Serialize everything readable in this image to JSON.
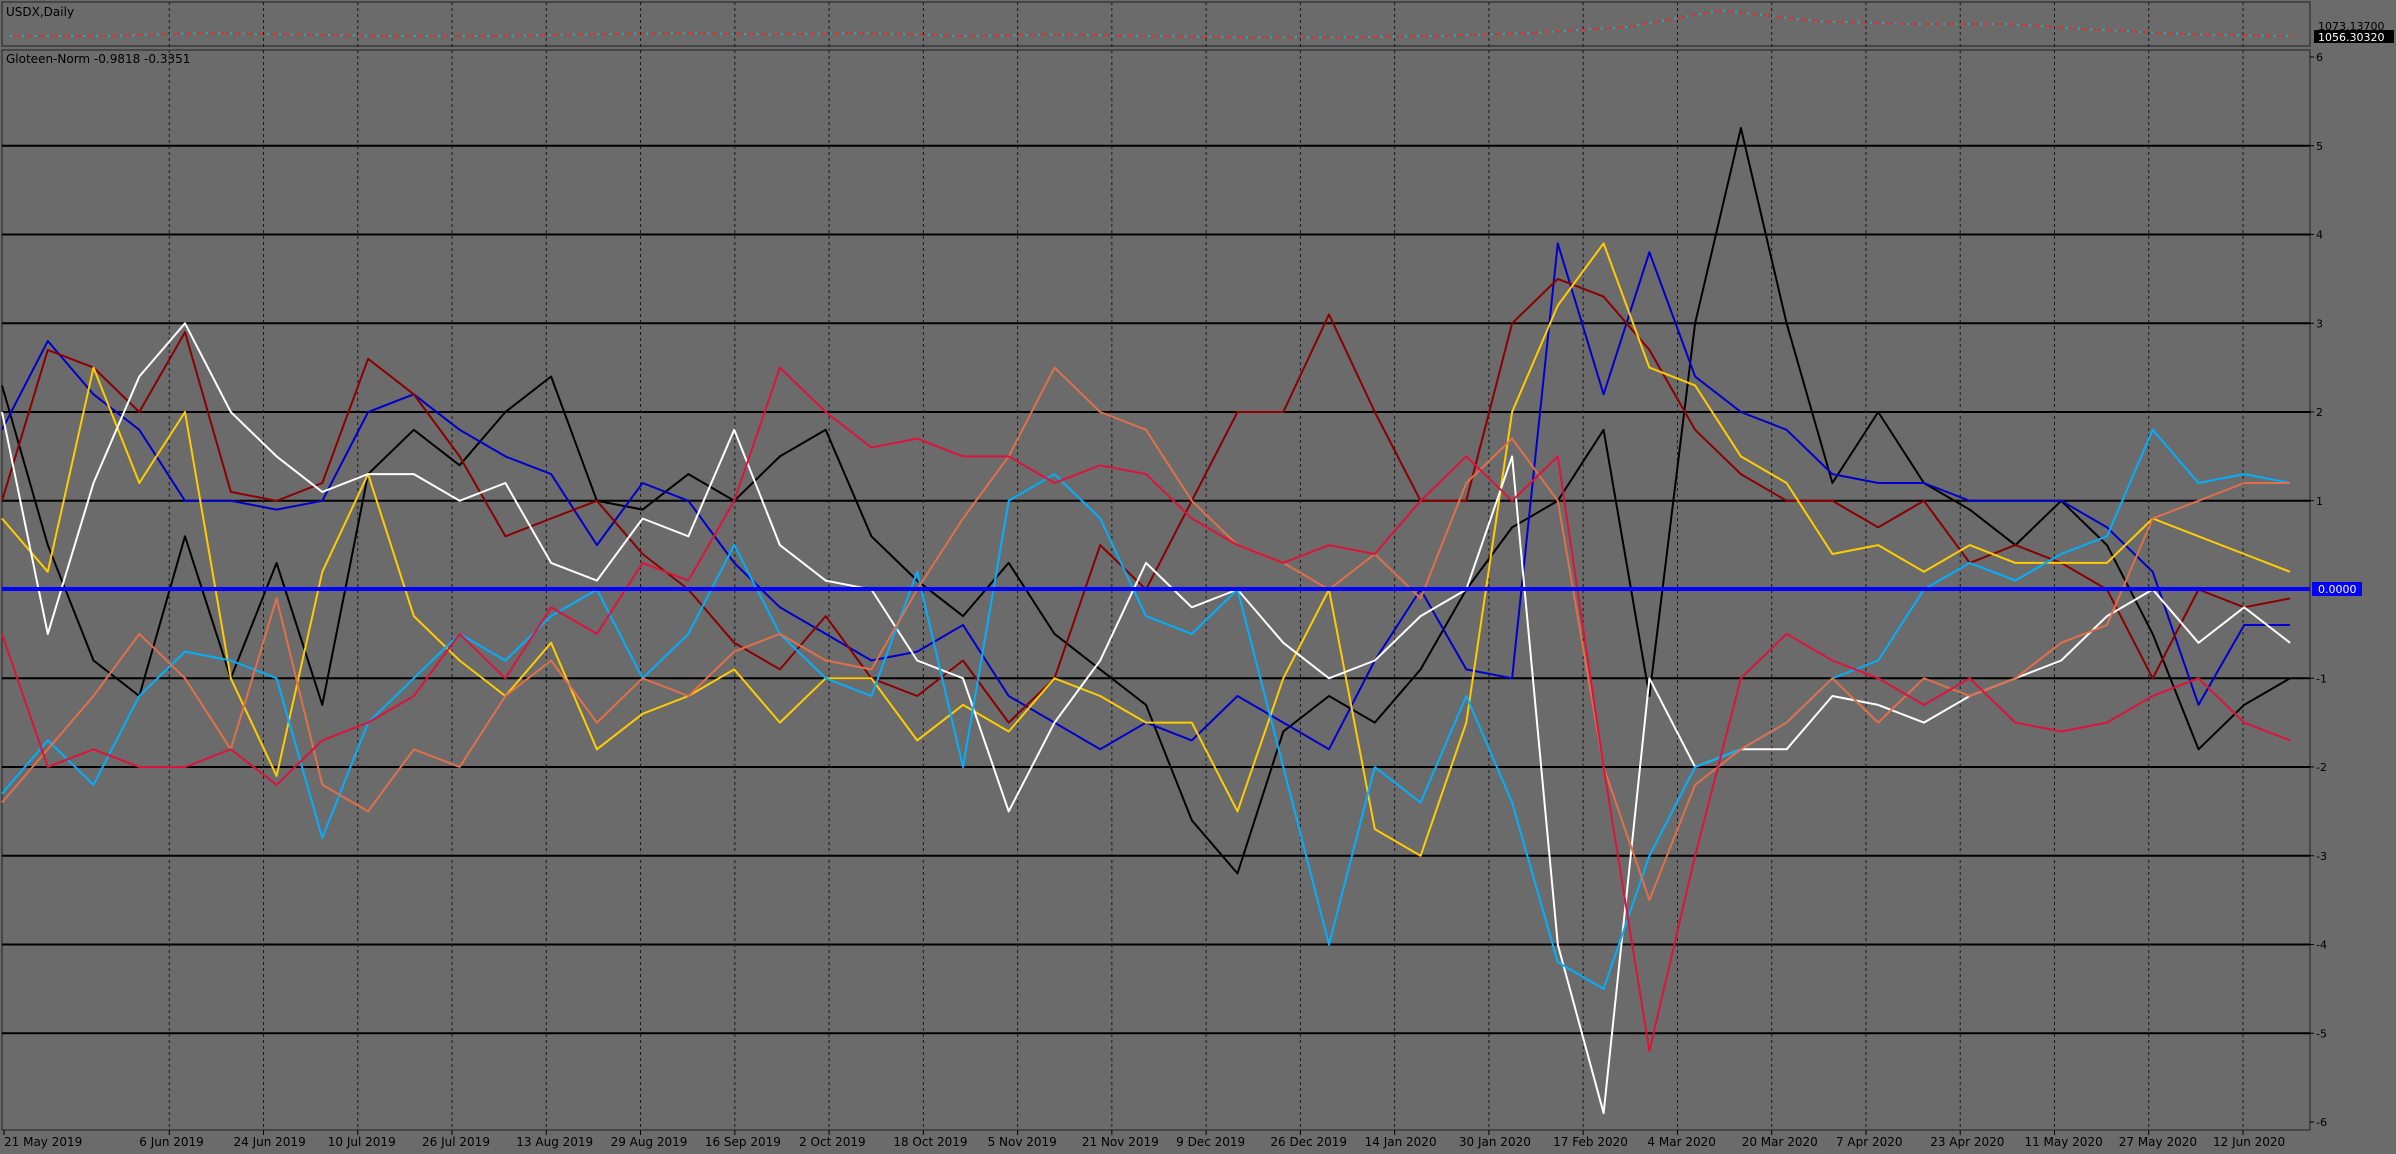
{
  "window": {
    "symbol_label": "USDX,Daily",
    "indicator_label": "Gloteen-Norm -0.9818 -0.3351"
  },
  "top_panel": {
    "price_high_label": "1073.13700",
    "price_current_label": "1056.30320",
    "colors": {
      "up": "#00c0c0",
      "down": "#ff2020",
      "background": "#6b6b6b"
    }
  },
  "zero_marker_label": "0.0000",
  "colors": {
    "background": "#6b6b6b",
    "grid_solid": "#000000",
    "grid_dashed": "#1a1a1a",
    "zero_line": "#0000ff",
    "axis_text": "#000000"
  },
  "chart_data": {
    "type": "line",
    "x_labels": [
      "21 May 2019",
      "6 Jun 2019",
      "24 Jun 2019",
      "10 Jul 2019",
      "26 Jul 2019",
      "13 Aug 2019",
      "29 Aug 2019",
      "16 Sep 2019",
      "2 Oct 2019",
      "18 Oct 2019",
      "5 Nov 2019",
      "21 Nov 2019",
      "9 Dec 2019",
      "26 Dec 2019",
      "14 Jan 2020",
      "30 Jan 2020",
      "17 Feb 2020",
      "4 Mar 2020",
      "20 Mar 2020",
      "7 Apr 2020",
      "23 Apr 2020",
      "11 May 2020",
      "27 May 2020",
      "12 Jun 2020"
    ],
    "y_ticks": [
      "6",
      "5",
      "4",
      "3",
      "2",
      "1",
      "-1",
      "-2",
      "-3",
      "-4",
      "-5",
      "-6"
    ],
    "ylim": [
      -6,
      6
    ],
    "grid": true,
    "zero_line": 0,
    "series": [
      {
        "color": "#000000",
        "values": [
          2.3,
          0.5,
          -0.8,
          -1.2,
          0.6,
          -1.0,
          0.3,
          -1.3,
          1.3,
          1.8,
          1.4,
          2.0,
          2.4,
          1.0,
          0.9,
          1.3,
          1.0,
          1.5,
          1.8,
          0.6,
          0.1,
          -0.3,
          0.3,
          -0.5,
          -0.9,
          -1.3,
          -2.6,
          -3.2,
          -1.6,
          -1.2,
          -1.5,
          -0.9,
          0.0,
          0.7,
          1.0,
          1.8,
          -1.2,
          3.0,
          5.2,
          3.0,
          1.2,
          2.0,
          1.2,
          0.9,
          0.5,
          1.0,
          0.5,
          -0.5,
          -1.8,
          -1.3,
          -1.0
        ]
      },
      {
        "color": "#0000cc",
        "values": [
          1.8,
          2.8,
          2.2,
          1.8,
          1.0,
          1.0,
          0.9,
          1.0,
          2.0,
          2.2,
          1.8,
          1.5,
          1.3,
          0.5,
          1.2,
          1.0,
          0.3,
          -0.2,
          -0.5,
          -0.8,
          -0.7,
          -0.4,
          -1.2,
          -1.5,
          -1.8,
          -1.5,
          -1.7,
          -1.2,
          -1.5,
          -1.8,
          -0.8,
          0.0,
          -0.9,
          -1.0,
          3.9,
          2.2,
          3.8,
          2.4,
          2.0,
          1.8,
          1.3,
          1.2,
          1.2,
          1.0,
          1.0,
          1.0,
          0.7,
          0.2,
          -1.3,
          -0.4,
          -0.4
        ]
      },
      {
        "color": "#8b0000",
        "values": [
          1.0,
          2.7,
          2.5,
          2.0,
          2.9,
          1.1,
          1.0,
          1.2,
          2.6,
          2.2,
          1.5,
          0.6,
          0.8,
          1.0,
          0.4,
          0.0,
          -0.6,
          -0.9,
          -0.3,
          -1.0,
          -1.2,
          -0.8,
          -1.5,
          -1.0,
          0.5,
          0.0,
          1.0,
          2.0,
          2.0,
          3.1,
          2.0,
          1.0,
          1.0,
          3.0,
          3.5,
          3.3,
          2.7,
          1.8,
          1.3,
          1.0,
          1.0,
          0.7,
          1.0,
          0.3,
          0.5,
          0.3,
          0.0,
          -1.0,
          0.0,
          -0.2,
          -0.1
        ]
      },
      {
        "color": "#ffcc00",
        "values": [
          0.8,
          0.2,
          2.5,
          1.2,
          2.0,
          -1.0,
          -2.1,
          0.2,
          1.3,
          -0.3,
          -0.8,
          -1.2,
          -0.6,
          -1.8,
          -1.4,
          -1.2,
          -0.9,
          -1.5,
          -1.0,
          -1.0,
          -1.7,
          -1.3,
          -1.6,
          -1.0,
          -1.2,
          -1.5,
          -1.5,
          -2.5,
          -1.0,
          0.0,
          -2.7,
          -3.0,
          -1.5,
          2.0,
          3.2,
          3.9,
          2.5,
          2.3,
          1.5,
          1.2,
          0.4,
          0.5,
          0.2,
          0.5,
          0.3,
          0.3,
          0.3,
          0.8,
          0.6,
          0.4,
          0.2
        ]
      },
      {
        "color": "#ffffff",
        "values": [
          2.0,
          -0.5,
          1.2,
          2.4,
          3.0,
          2.0,
          1.5,
          1.1,
          1.3,
          1.3,
          1.0,
          1.2,
          0.3,
          0.1,
          0.8,
          0.6,
          1.8,
          0.5,
          0.1,
          0.0,
          -0.8,
          -1.0,
          -2.5,
          -1.5,
          -0.8,
          0.3,
          -0.2,
          0.0,
          -0.6,
          -1.0,
          -0.8,
          -0.3,
          0.0,
          1.5,
          -4.0,
          -5.9,
          -1.0,
          -2.0,
          -1.8,
          -1.8,
          -1.2,
          -1.3,
          -1.5,
          -1.2,
          -1.0,
          -0.8,
          -0.3,
          0.0,
          -0.6,
          -0.2,
          -0.6
        ]
      },
      {
        "color": "#00b0ff",
        "values": [
          -2.3,
          -1.7,
          -2.2,
          -1.2,
          -0.7,
          -0.8,
          -1.0,
          -2.8,
          -1.5,
          -1.0,
          -0.5,
          -0.8,
          -0.3,
          0.0,
          -1.0,
          -0.5,
          0.5,
          -0.5,
          -1.0,
          -1.2,
          0.2,
          -2.0,
          1.0,
          1.3,
          0.8,
          -0.3,
          -0.5,
          0.0,
          -2.0,
          -4.0,
          -2.0,
          -2.4,
          -1.2,
          -2.4,
          -4.2,
          -4.5,
          -3.0,
          -2.0,
          -1.8,
          -1.5,
          -1.0,
          -0.8,
          0.0,
          0.3,
          0.1,
          0.4,
          0.6,
          1.8,
          1.2,
          1.3,
          1.2
        ]
      },
      {
        "color": "#e0704a",
        "values": [
          -2.4,
          -1.8,
          -1.2,
          -0.5,
          -1.0,
          -1.8,
          -0.1,
          -2.2,
          -2.5,
          -1.8,
          -2.0,
          -1.2,
          -0.8,
          -1.5,
          -1.0,
          -1.2,
          -0.7,
          -0.5,
          -0.8,
          -0.9,
          0.0,
          0.8,
          1.5,
          2.5,
          2.0,
          1.8,
          1.0,
          0.5,
          0.3,
          0.0,
          0.4,
          -0.1,
          1.2,
          1.7,
          1.0,
          -2.0,
          -3.5,
          -2.2,
          -1.8,
          -1.5,
          -1.0,
          -1.5,
          -1.0,
          -1.2,
          -1.0,
          -0.6,
          -0.4,
          0.8,
          1.0,
          1.2,
          1.2
        ]
      },
      {
        "color": "#dc143c",
        "values": [
          -0.5,
          -2.0,
          -1.8,
          -2.0,
          -2.0,
          -1.8,
          -2.2,
          -1.7,
          -1.5,
          -1.2,
          -0.5,
          -1.0,
          -0.2,
          -0.5,
          0.3,
          0.1,
          1.0,
          2.5,
          2.0,
          1.6,
          1.7,
          1.5,
          1.5,
          1.2,
          1.4,
          1.3,
          0.8,
          0.5,
          0.3,
          0.5,
          0.4,
          1.0,
          1.5,
          1.0,
          1.5,
          -2.0,
          -5.2,
          -3.0,
          -1.0,
          -0.5,
          -0.8,
          -1.0,
          -1.3,
          -1.0,
          -1.5,
          -1.6,
          -1.5,
          -1.2,
          -1.0,
          -1.5,
          -1.7
        ]
      }
    ]
  }
}
